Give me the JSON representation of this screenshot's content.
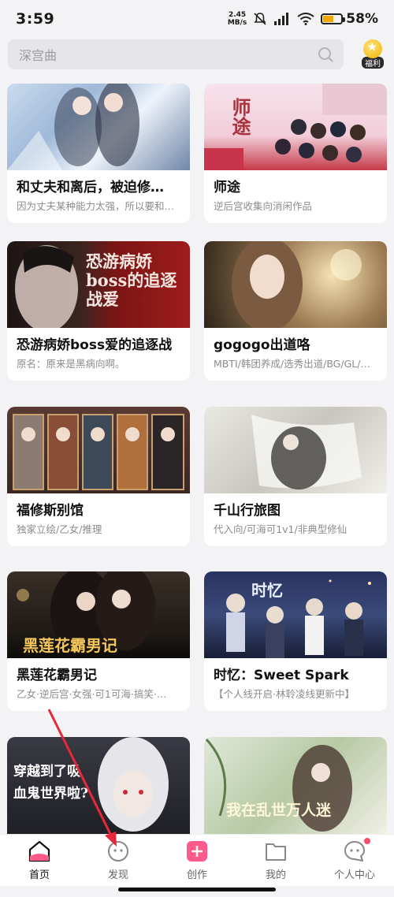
{
  "status": {
    "time": "3:59",
    "net_speed_value": "2.45",
    "net_speed_unit": "MB/s",
    "battery": "58%"
  },
  "search": {
    "placeholder": "深宫曲",
    "welfare_label": "福利"
  },
  "cards": [
    {
      "title": "和丈夫和离后，被迫修…",
      "desc": "因为丈夫某种能力太强，所以要和…",
      "cover_text": ""
    },
    {
      "title": "师途",
      "desc": "逆后宫收集向消闲作品",
      "cover_text": "师途"
    },
    {
      "title": "恐游病娇boss爱的追逐战",
      "desc": "原名：原来是黑病向啊。",
      "cover_text": "恐游病娇boss的追逐战爱"
    },
    {
      "title": "gogogo出道咯",
      "desc": "MBTI/韩团养成/选秀出道/BG/GL/…",
      "cover_text": ""
    },
    {
      "title": "福修斯别馆",
      "desc": "独家立绘/乙女/推理",
      "cover_text": ""
    },
    {
      "title": "千山行旅图",
      "desc": "代入向/可海可1v1/非典型修仙",
      "cover_text": ""
    },
    {
      "title": "黑莲花霸男记",
      "desc": "乙女·逆后宫·女强·可1可海·搞笑·…",
      "cover_text": "黑莲花霸男记"
    },
    {
      "title": "时忆：Sweet Spark",
      "desc": "【个人线开启·林聆凌线更新中】",
      "cover_text": "时忆"
    },
    {
      "title": "",
      "desc": "",
      "cover_text": "穿越到了吸血鬼世界啦?"
    },
    {
      "title": "",
      "desc": "",
      "cover_text": "我在乱世万人迷"
    }
  ],
  "nav": {
    "home": "首页",
    "discover": "发现",
    "create": "创作",
    "mine": "我的",
    "personal": "个人中心"
  },
  "colors": {
    "accent_pink": "#ff5a8a",
    "background": "#f3f3f5",
    "annotation_red": "#e8283a"
  }
}
